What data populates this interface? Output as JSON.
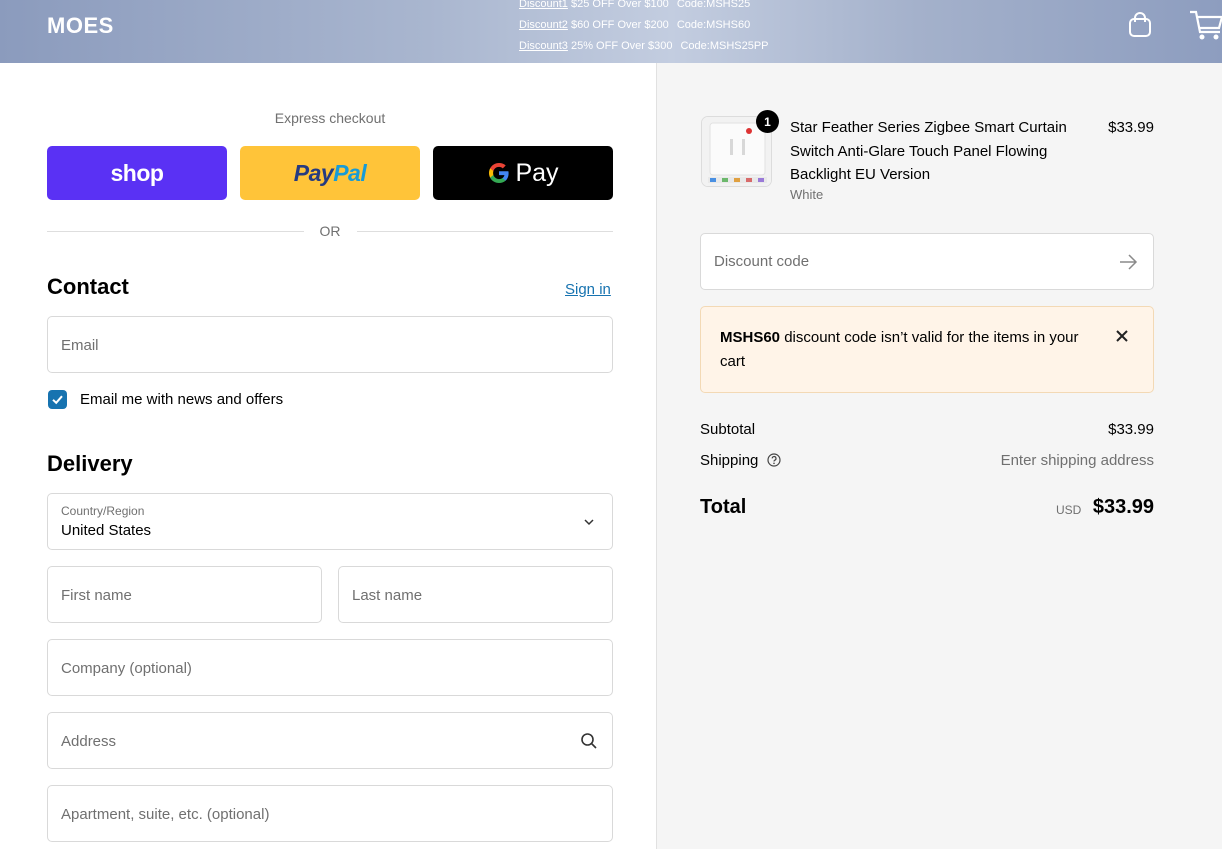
{
  "header": {
    "logo": "MOES",
    "promos": [
      {
        "link": "Discount1",
        "text": " $25 OFF Over $100",
        "code": "Code:MSHS25"
      },
      {
        "link": "Discount2",
        "text": " $60 OFF Over $200",
        "code": "Code:MSHS60"
      },
      {
        "link": "Discount3",
        "text": " 25% OFF Over $300",
        "code": "Code:MSHS25PP"
      }
    ],
    "icons": [
      "shopping-bag-icon",
      "cart-icon"
    ]
  },
  "express": {
    "label": "Express checkout",
    "shop_label": "shop",
    "paypal_part1": "Pay",
    "paypal_part2": "Pal",
    "gpay_label": "Pay",
    "or_label": "OR"
  },
  "contact": {
    "title": "Contact",
    "signin_label": "Sign in",
    "email_placeholder": "Email",
    "newsletter_label": "Email me with news and offers",
    "newsletter_checked": true
  },
  "delivery": {
    "title": "Delivery",
    "country_label": "Country/Region",
    "country_value": "United States",
    "first_name_placeholder": "First name",
    "last_name_placeholder": "Last name",
    "company_placeholder": "Company (optional)",
    "address_placeholder": "Address",
    "apartment_placeholder": "Apartment, suite, etc. (optional)"
  },
  "summary": {
    "product": {
      "quantity": "1",
      "name": "Star Feather Series Zigbee Smart Curtain Switch Anti-Glare Touch Panel Flowing Backlight EU Version",
      "variant": "White",
      "price": "$33.99"
    },
    "discount_placeholder": "Discount code",
    "alert": {
      "code": "MSHS60",
      "message": " discount code isn’t valid for the items in your cart"
    },
    "subtotal_label": "Subtotal",
    "subtotal_value": "$33.99",
    "shipping_label": "Shipping",
    "shipping_value": "Enter shipping address",
    "total_label": "Total",
    "currency": "USD",
    "total_value": "$33.99"
  },
  "colors": {
    "shop_purple": "#5a31f4",
    "paypal_yellow": "#ffc439",
    "link_blue": "#1773b0",
    "alert_bg": "#fff4e8"
  }
}
